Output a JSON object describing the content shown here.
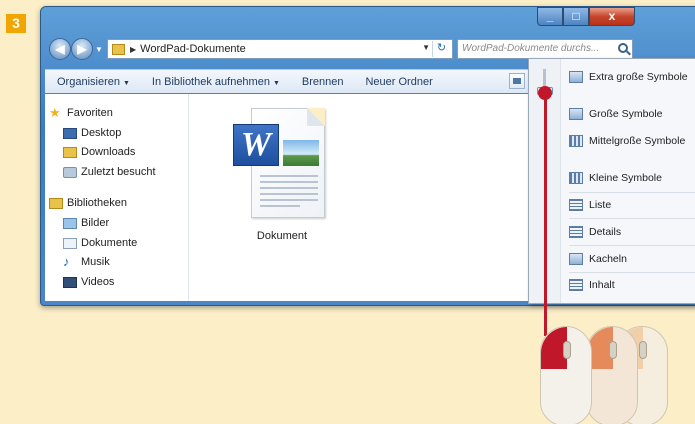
{
  "step": {
    "number": "3"
  },
  "window": {
    "controls": {
      "minimize": "_",
      "maximize": "□",
      "close": "x"
    },
    "nav": {
      "back_glyph": "◀",
      "forward_glyph": "▶"
    },
    "address": {
      "breadcrumb": "WordPad-Dokumente",
      "separator": "▶"
    },
    "search": {
      "placeholder": "WordPad-Dokumente durchs..."
    }
  },
  "toolbar": {
    "items": [
      "Organisieren",
      "In Bibliothek aufnehmen",
      "Brennen",
      "Neuer Ordner"
    ]
  },
  "navpane": {
    "favorites": {
      "label": "Favoriten",
      "items": [
        "Desktop",
        "Downloads",
        "Zuletzt besucht"
      ]
    },
    "libraries": {
      "label": "Bibliotheken",
      "items": [
        "Bilder",
        "Dokumente",
        "Musik",
        "Videos"
      ]
    }
  },
  "files": [
    {
      "name": "Dokument",
      "icon": "word-document-icon"
    }
  ],
  "view_menu": {
    "items": [
      "Extra große Symbole",
      "Große Symbole",
      "Mittelgroße Symbole",
      "Kleine Symbole",
      "Liste",
      "Details",
      "Kacheln",
      "Inhalt"
    ],
    "selected_level": "Extra große Symbole"
  },
  "colors": {
    "accent": "#c0172a",
    "badge": "#f0a500",
    "window_frame": "#3b7bc0",
    "background": "#fcefc8"
  }
}
